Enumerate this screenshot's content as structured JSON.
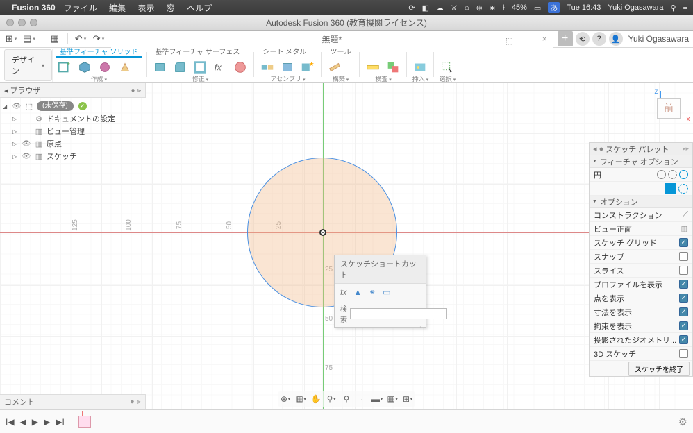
{
  "macbar": {
    "app": "Fusion 360",
    "menus": [
      "ファイル",
      "編集",
      "表示",
      "窓",
      "ヘルプ"
    ],
    "battery": "45%",
    "time": "Tue 16:43",
    "user": "Yuki Ogasawara"
  },
  "titlebar": "Autodesk Fusion 360 (教育機関ライセンス)",
  "tab": {
    "name": "無題*"
  },
  "user": "Yuki Ogasawara",
  "ws": "デザイン",
  "toolbar": {
    "g1": {
      "tabs": [
        "基準フィーチャ ソリッド",
        "基準フィーチャ サーフェス",
        "シート メタル",
        "ツール"
      ],
      "lbl": "作成"
    },
    "g2": {
      "lbl": "修正"
    },
    "g3": {
      "lbl": "アセンブリ"
    },
    "g4": {
      "lbl": "構築"
    },
    "g5": {
      "lbl": "検査"
    },
    "g6": {
      "lbl": "挿入"
    },
    "g7": {
      "lbl": "選択"
    }
  },
  "browser": {
    "title": "ブラウザ",
    "root": "(未保存)",
    "items": [
      "ドキュメントの設定",
      "ビュー管理",
      "原点",
      "スケッチ"
    ]
  },
  "ruler": [
    "125",
    "100",
    "75",
    "50",
    "25"
  ],
  "rulerv": [
    "25",
    "50",
    "75"
  ],
  "cube": "前",
  "popup": {
    "title": "スケッチショートカット",
    "search": "検索"
  },
  "palette": {
    "title": "スケッチ パレット",
    "s1": "フィーチャ オプション",
    "r_circle": "円",
    "s2": "オプション",
    "rows": [
      {
        "t": "コンストラクション",
        "k": "icon"
      },
      {
        "t": "ビュー正面",
        "k": "icon"
      },
      {
        "t": "スケッチ グリッド",
        "k": "on"
      },
      {
        "t": "スナップ",
        "k": "off"
      },
      {
        "t": "スライス",
        "k": "off"
      },
      {
        "t": "プロファイルを表示",
        "k": "on"
      },
      {
        "t": "点を表示",
        "k": "on"
      },
      {
        "t": "寸法を表示",
        "k": "on"
      },
      {
        "t": "拘束を表示",
        "k": "on"
      },
      {
        "t": "投影されたジオメトリ...",
        "k": "on"
      },
      {
        "t": "3D スケッチ",
        "k": "off"
      }
    ],
    "finish": "スケッチを終了"
  },
  "comment": "コメント"
}
